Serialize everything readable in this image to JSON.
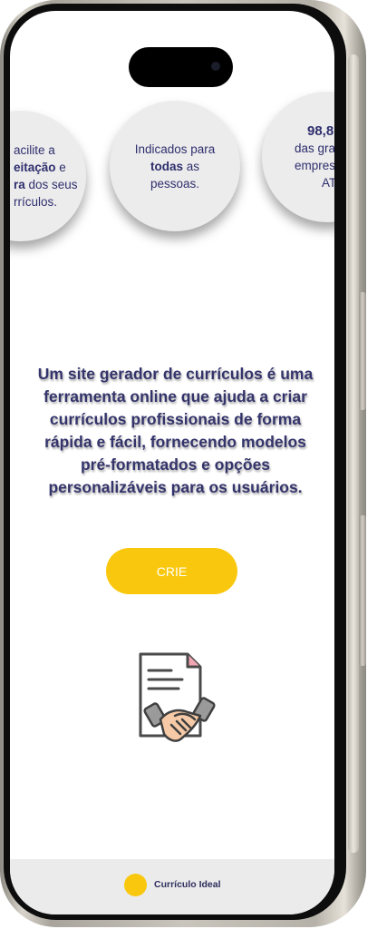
{
  "circles": [
    {
      "pre": "acilite a ",
      "line2_bold": "eitação",
      "line2_rest": " e",
      "line3_bold": "ra",
      "line3_rest": " dos seus",
      "line4": "rrículos."
    },
    {
      "line1": "Indicados para",
      "bold": "todas",
      "rest": " as",
      "line3": "pessoas."
    },
    {
      "bold": "98,8",
      "line2": "das gran",
      "line3": "empresas",
      "line4": "ATS."
    }
  ],
  "headline": "Um site gerador de currículos é uma ferramenta online que ajuda a criar currículos profissionais de forma rápida e fácil, fornecendo modelos pré-formatados e opções personalizáveis para os usuários.",
  "cta_label": "CRIE",
  "brand": "Currículo Ideal",
  "colors": {
    "accent": "#f9c80e",
    "text": "#34346c"
  },
  "icons": [
    "document-handshake-icon"
  ]
}
